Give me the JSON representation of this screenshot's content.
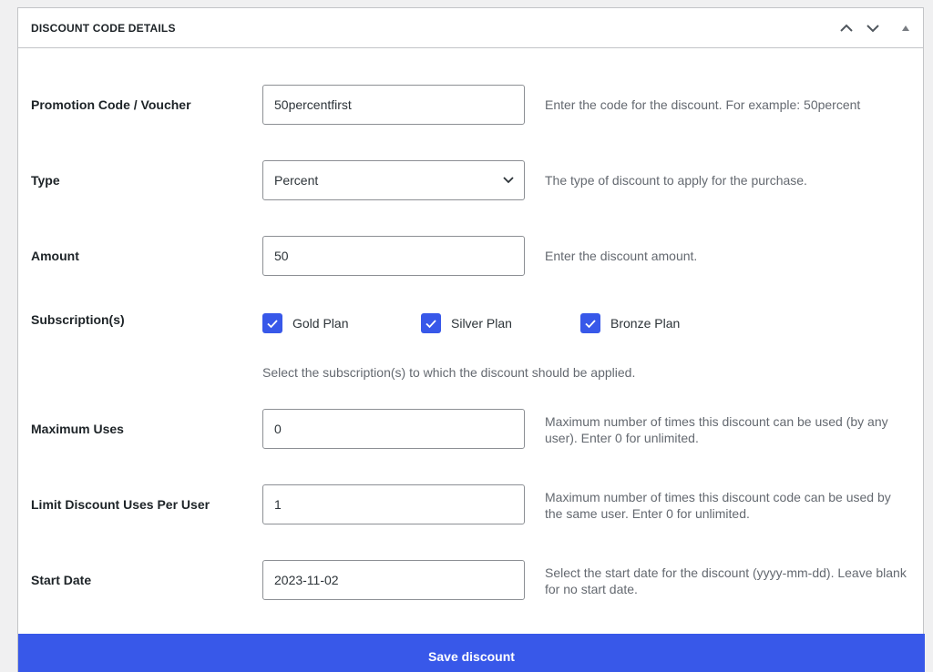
{
  "panel": {
    "title": "DISCOUNT CODE DETAILS",
    "icons": [
      "chevron-up-icon",
      "chevron-down-icon",
      "caret-up-icon"
    ]
  },
  "fields": {
    "code": {
      "label": "Promotion Code / Voucher",
      "value": "50percentfirst",
      "desc": "Enter the code for the discount. For example: 50percent"
    },
    "type": {
      "label": "Type",
      "value": "Percent",
      "desc": "The type of discount to apply for the purchase."
    },
    "amount": {
      "label": "Amount",
      "value": "50",
      "desc": "Enter the discount amount."
    },
    "subscriptions": {
      "label": "Subscription(s)",
      "options": [
        {
          "label": "Gold Plan",
          "checked": true
        },
        {
          "label": "Silver Plan",
          "checked": true
        },
        {
          "label": "Bronze Plan",
          "checked": true
        }
      ],
      "desc": "Select the subscription(s) to which the discount should be applied."
    },
    "max_uses": {
      "label": "Maximum Uses",
      "value": "0",
      "desc": "Maximum number of times this discount can be used (by any user). Enter 0 for unlimited."
    },
    "per_user": {
      "label": "Limit Discount Uses Per User",
      "value": "1",
      "desc": "Maximum number of times this discount code can be used by the same user. Enter 0 for unlimited."
    },
    "start_date": {
      "label": "Start Date",
      "value": "2023-11-02",
      "desc": "Select the start date for the discount (yyyy-mm-dd). Leave blank for no start date."
    }
  },
  "actions": {
    "save_label": "Save discount"
  },
  "colors": {
    "accent": "#3858e9",
    "border": "#c3c4c7",
    "muted_text": "#646970"
  }
}
